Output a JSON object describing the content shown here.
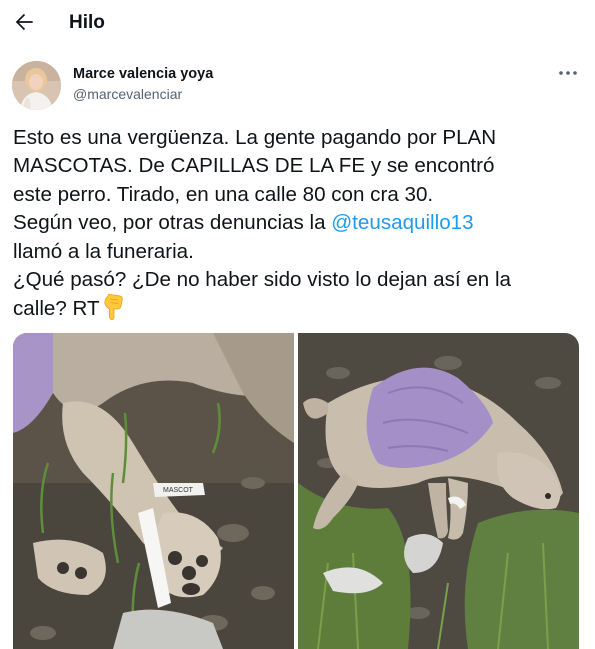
{
  "header": {
    "back_icon": "arrow-left-icon",
    "title": "Hilo"
  },
  "author": {
    "name": "Marce valencia yoya",
    "handle": "@marcevalenciar",
    "more_icon": "more-horizontal-icon"
  },
  "tweet": {
    "lines": [
      "Esto es una vergüenza. La gente pagando por PLAN",
      "MASCOTAS. De CAPILLAS DE LA FE y se encontró",
      "este perro. Tirado, en una calle 80 con cra 30."
    ],
    "line4_before": "Según veo, por otras denuncias la ",
    "mention": "@teusaquillo13",
    "line5": "llamó a la funeraria.",
    "line6": "¿Qué pasó? ¿De no haber sido visto lo dejan así en la",
    "line7": "calle? RT",
    "emoji": "pointing-down-hand-icon"
  },
  "media": {
    "photos": [
      "dog-paw-wristband-photo",
      "dog-lying-towel-photo"
    ],
    "wristband_text": "MASCOT"
  },
  "colors": {
    "text": "#0f1419",
    "secondary": "#536471",
    "link": "#1d9bf0"
  }
}
